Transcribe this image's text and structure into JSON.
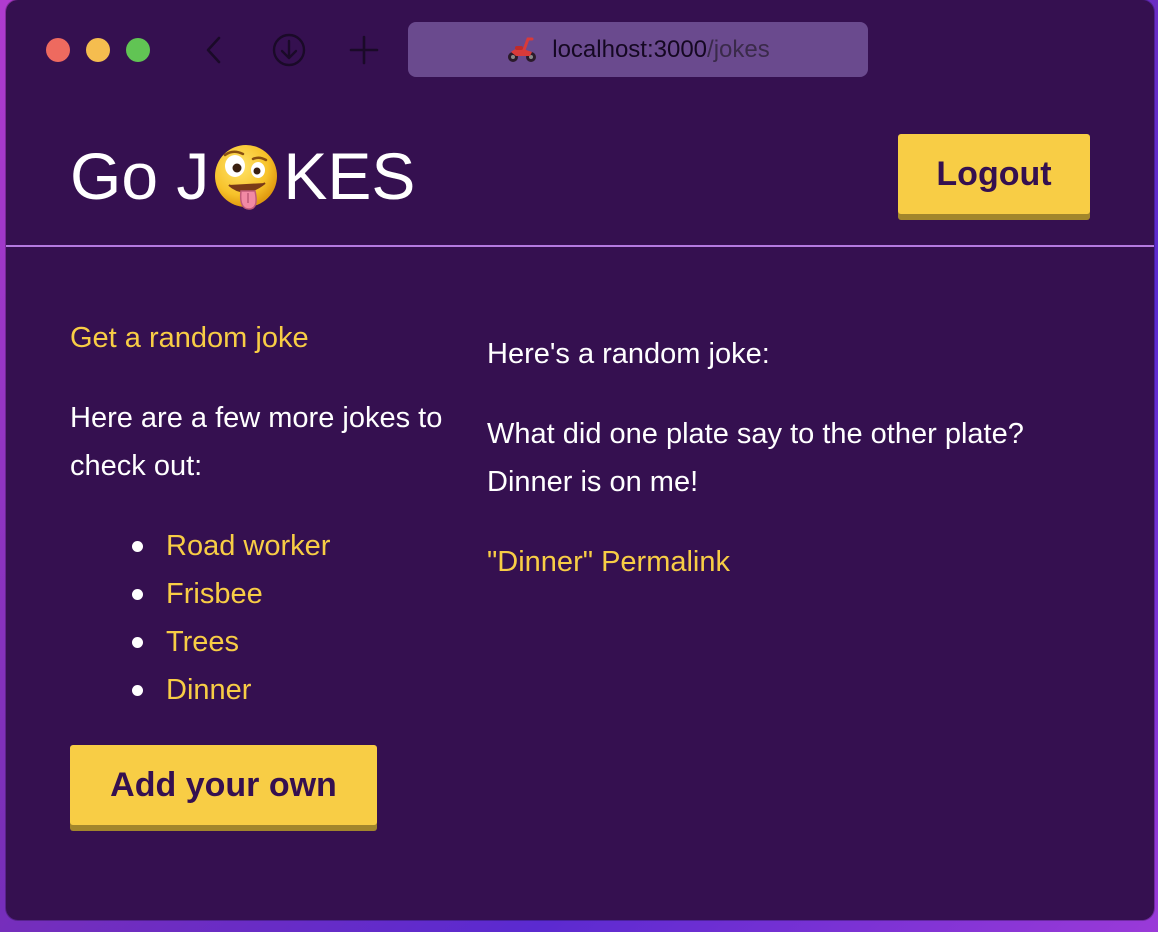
{
  "browser": {
    "url_host": "localhost:3000",
    "url_path": "/jokes",
    "back_icon": "chevron-left-icon",
    "download_icon": "download-icon",
    "new_tab_icon": "plus-icon",
    "site_icon": "scooter-icon"
  },
  "header": {
    "brand_prefix": "Go J",
    "brand_emoji": "zany-face-icon",
    "brand_suffix": "KES",
    "logout_label": "Logout"
  },
  "sidebar": {
    "random_link": "Get a random joke",
    "more_text": "Here are a few more jokes to check out:",
    "jokes": [
      {
        "label": "Road worker"
      },
      {
        "label": "Frisbee"
      },
      {
        "label": "Trees"
      },
      {
        "label": "Dinner"
      }
    ],
    "add_label": "Add your own"
  },
  "main": {
    "heading": "Here's a random joke:",
    "joke": "What did one plate say to the other plate? Dinner is on me!",
    "permalink": "\"Dinner\" Permalink"
  },
  "colors": {
    "background": "#351050",
    "accent": "#f8cd45",
    "divider": "#b47ae0",
    "text": "#ffffff"
  }
}
